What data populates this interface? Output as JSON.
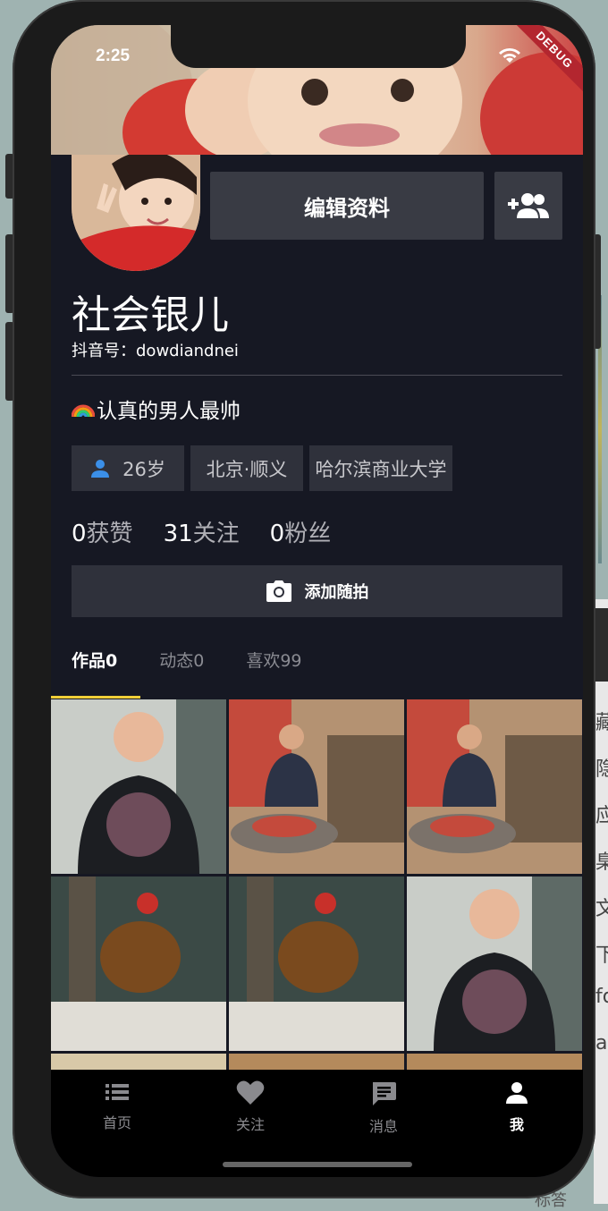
{
  "status_bar": {
    "time": "2:25",
    "debug_label": "DEBUG"
  },
  "profile": {
    "edit_button": "编辑资料",
    "nickname": "社会银儿",
    "douyin_id": "抖音号：dowdiandnei",
    "bio": "认真的男人最帅",
    "tags": {
      "age": "26岁",
      "location": "北京·顺义",
      "school": "哈尔滨商业大学"
    },
    "stats": [
      {
        "num": "0",
        "label": "获赞"
      },
      {
        "num": "31",
        "label": "关注"
      },
      {
        "num": "0",
        "label": "粉丝"
      }
    ],
    "quick_shoot": "添加随拍"
  },
  "tabs": [
    {
      "label": "作品0",
      "active": true
    },
    {
      "label": "动态0",
      "active": false
    },
    {
      "label": "喜欢99",
      "active": false
    }
  ],
  "bottom_nav": [
    {
      "label": "首页",
      "icon": "list-icon"
    },
    {
      "label": "关注",
      "icon": "heart-icon"
    },
    {
      "label": "消息",
      "icon": "message-icon"
    },
    {
      "label": "我",
      "icon": "person-icon",
      "active": true
    }
  ],
  "colors": {
    "background": "#161823",
    "accent": "#f2d038",
    "button": "#393b44",
    "tag": "#2f313b"
  },
  "background_panel": {
    "chars": [
      "藏",
      "隐",
      "应",
      "臬",
      "文",
      "下",
      "fo",
      "a"
    ],
    "bottom_text": "标答"
  }
}
